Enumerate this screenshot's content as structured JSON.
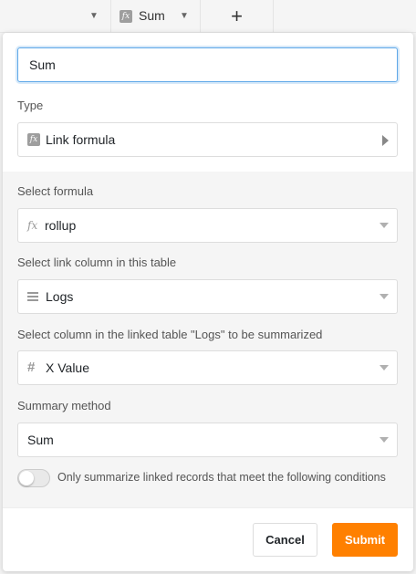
{
  "grid_header": {
    "column_name": "Sum",
    "add_column_symbol": "+"
  },
  "dialog": {
    "name_value": "Sum",
    "type_label": "Type",
    "type_value": "Link formula",
    "formula_label": "Select formula",
    "formula_value": "rollup",
    "link_column_label": "Select link column in this table",
    "link_column_value": "Logs",
    "summarize_column_label": "Select column in the linked table \"Logs\" to be summarized",
    "summarize_column_value": "X Value",
    "summary_method_label": "Summary method",
    "summary_method_value": "Sum",
    "condition_toggle_label": "Only summarize linked records that meet the following conditions",
    "condition_toggle_on": false,
    "cancel_label": "Cancel",
    "submit_label": "Submit"
  },
  "icons": {
    "type": "formula-icon",
    "formula": "fx-icon",
    "link_column": "link-list-icon",
    "summarize_column": "number-hash-icon"
  },
  "colors": {
    "accent": "#ff8000",
    "focus_border": "#5fa8e8"
  }
}
